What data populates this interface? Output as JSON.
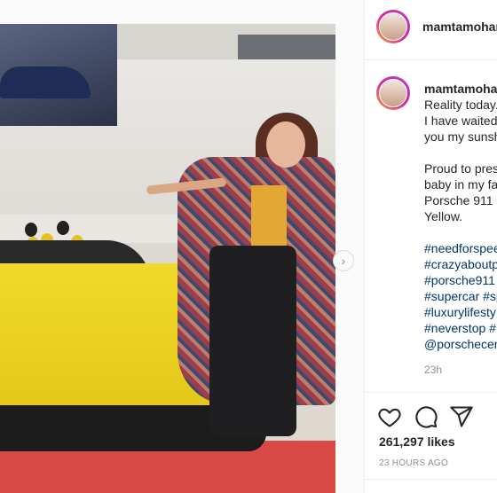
{
  "post": {
    "username": "mamtamohar",
    "caption_lines": [
      "Reality today..",
      "I have waited",
      "you my sunsh",
      "",
      "Proud to pres",
      "baby in my fa",
      "Porsche 911 C",
      "Yellow."
    ],
    "hashtag_lines": [
      "#needforspee",
      "#crazyaboutp",
      "#porsche911",
      "#supercar #sp",
      "#luxurylifesty",
      "#neverstop #",
      "@porschecen"
    ],
    "caption_time": "23h",
    "likes": "261,297 likes",
    "posted": "23 HOURS AGO"
  },
  "colors": {
    "link": "#00376b",
    "car_yellow": "#f1d92a",
    "floor_red": "#d94a47"
  },
  "icons": {
    "like": "heart-icon",
    "comment": "comment-icon",
    "share": "share-icon",
    "next": "chevron-right-icon"
  }
}
